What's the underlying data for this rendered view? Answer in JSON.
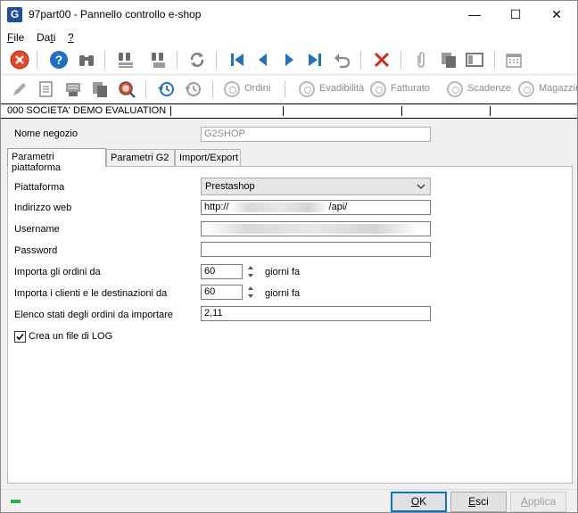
{
  "window": {
    "app_icon": "G",
    "title": "97part00 - Pannello controllo e-shop",
    "minimize": "—",
    "maximize": "☐",
    "close": "✕"
  },
  "menu": {
    "items": [
      {
        "label": "File",
        "mnemonic": "F",
        "rest": "ile"
      },
      {
        "label": "Dati",
        "mnemonic": "t",
        "pre": "Da",
        "rest": "i"
      },
      {
        "label": "?",
        "mnemonic": "?"
      }
    ]
  },
  "toolbar2": {
    "labels": [
      "Ordini",
      "Evadibilità",
      "Fatturato",
      "Scadenze",
      "Magazzin"
    ]
  },
  "company": {
    "text": "000 SOCIETA' DEMO EVALUATION"
  },
  "form": {
    "shop_name_label": "Nome negozio",
    "shop_name_value": "G2SHOP"
  },
  "tabs": [
    {
      "label": "Parametri piattaforma",
      "active": true
    },
    {
      "label": "Parametri G2",
      "active": false
    },
    {
      "label": "Import/Export",
      "active": false
    }
  ],
  "platform": {
    "platform_label": "Piattaforma",
    "platform_value": "Prestashop",
    "url_label": "Indirizzo web",
    "url_prefix": "http://",
    "url_suffix": "/api/",
    "username_label": "Username",
    "password_label": "Password",
    "orders_label": "Importa gli ordini da",
    "orders_value": "60",
    "orders_unit": "giorni fa",
    "clients_label": "Importa i clienti e le destinazioni da",
    "clients_value": "60",
    "clients_unit": "giorni fa",
    "states_label": "Elenco stati degli ordini da importare",
    "states_value": "2,11",
    "log_label": "Crea un file di LOG",
    "log_checked": true
  },
  "buttons": {
    "ok": "OK",
    "ok_mnemonic": "O",
    "ok_rest": "K",
    "esci": "Esci",
    "esci_mnemonic": "E",
    "esci_rest": "sci",
    "applica": "Applica",
    "applica_mnemonic": "A",
    "applica_rest": "pplica"
  }
}
